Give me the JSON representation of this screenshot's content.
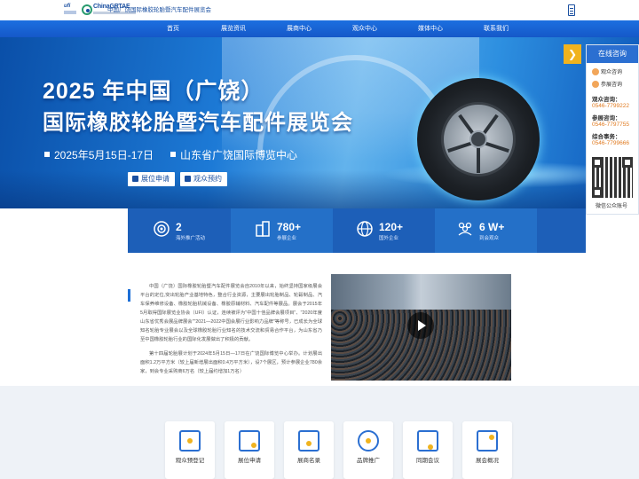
{
  "header": {
    "ufi_text": "ufi",
    "brand": "ChinaGRTAE",
    "title": "中国广饶国际橡胶轮胎暨汽车配件展览会"
  },
  "nav": {
    "items": [
      "首页",
      "展览资讯",
      "展商中心",
      "观众中心",
      "媒体中心",
      "联系我们"
    ]
  },
  "banner": {
    "title_line1": "2025 年中国（广饶）",
    "title_line2": "国际橡胶轮胎暨汽车配件展览会",
    "date": "2025年5月15日-17日",
    "venue": "山东省广饶国际博览中心",
    "btn_booth": "展位申请",
    "btn_visitor": "观众预约",
    "arrow": "❯"
  },
  "stats": [
    {
      "num": "2",
      "label": "海外推广活动"
    },
    {
      "num": "780+",
      "label": "参展企业"
    },
    {
      "num": "120+",
      "label": "国外企业"
    },
    {
      "num": "6 W+",
      "label": "到会观众"
    }
  ],
  "side": {
    "title": "在线咨询",
    "consult1": "观众咨询",
    "consult2": "参展咨询",
    "visitor_label": "观众咨询：",
    "visitor_tel": "0546-7799222",
    "exhibit_label": "参展咨询：",
    "exhibit_tel": "0546-7797755",
    "service_label": "综合事务：",
    "service_tel": "0546-7799666",
    "qr_label": "微信公众账号"
  },
  "intro": {
    "p1": "中国（广饶）国际橡胶轮胎暨汽车配件展览会自2010年以来，始终坚持国家级展会平台的定位,突出轮胎产业基地特色，整合行业资源，主要展出轮胎制品、轮毂制品、汽车保养维修设备、橡胶轮胎机械设备、橡胶原辅材料、汽车配件等展品。展会于2015年5月取得国际展览业协会（UFI）认证，连续被评为\"中国十佳品牌会展项目\"、\"2020年度山东省优秀会展品牌展会\"\"2021—2022中国会展行业影响力品牌\"等称号，已成长为全球知名轮胎专业展会以及全球橡胶轮胎行业知名的技术交流和贸易合作平台，为山东省乃至中国橡胶轮胎行业的国际化发展做出了积极的贡献。",
    "p2": "第十四届轮胎展计划于2024年5月15日—17日在广饶国际博览中心举办。计划展出面积1.2万平方米（较上届新增展出面积0.4万平方米），设7个展区，预计参展企业780余家，到会专业采购商6万名（较上届约增加1万名）"
  },
  "cards": [
    "观众预登记",
    "展位申请",
    "展商名录",
    "品牌推广",
    "同期会议",
    "展会概况"
  ],
  "colors": {
    "primary": "#1d6fd6",
    "accent": "#f0b31e",
    "tel": "#e07a1f"
  }
}
